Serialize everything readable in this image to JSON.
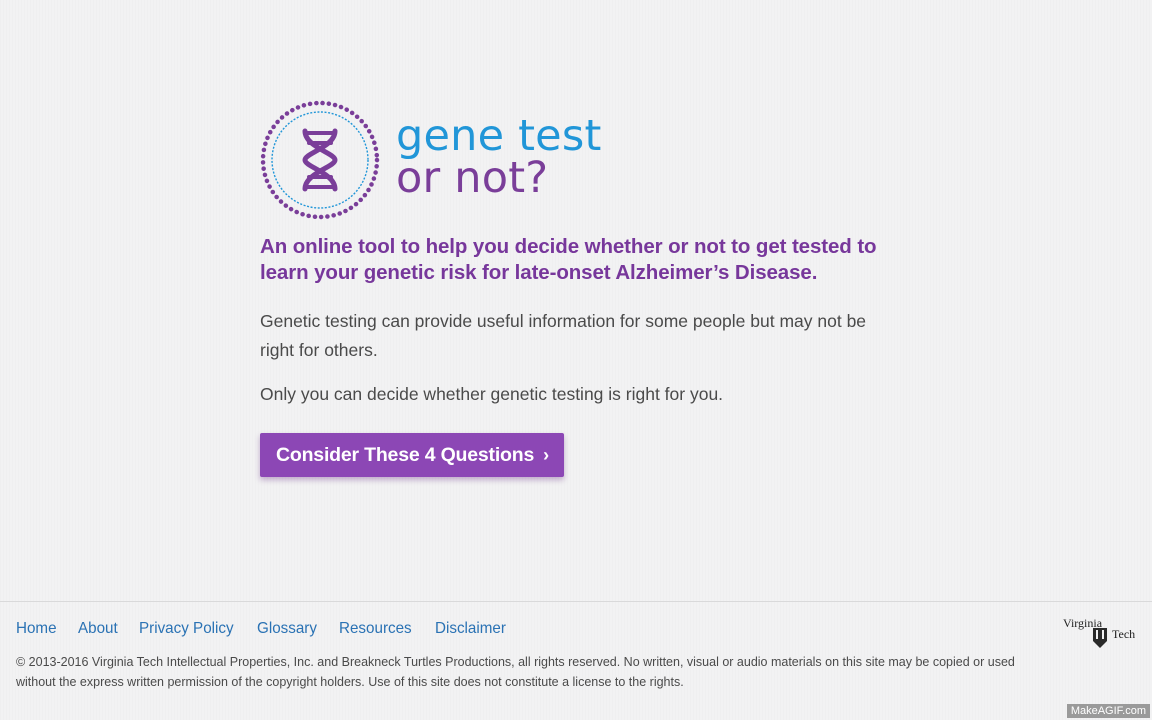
{
  "logo": {
    "line1": "gene test",
    "line2": "or not?",
    "badge_icon": "dna-icon"
  },
  "tagline": "An online tool to help you decide whether or not to get tested to learn your genetic risk for late-onset Alzheimer’s Disease.",
  "paragraphs": [
    "Genetic testing can provide useful information for some people but may not be right for others.",
    "Only you can decide whether genetic testing is right for you."
  ],
  "cta": {
    "label": "Consider These 4 Questions",
    "chevron": "›"
  },
  "footer": {
    "nav": [
      {
        "label": "Home"
      },
      {
        "label": "About"
      },
      {
        "label": "Privacy Policy"
      },
      {
        "label": "Glossary"
      },
      {
        "label": "Resources"
      },
      {
        "label": "Disclaimer"
      }
    ],
    "copyright": "© 2013-2016 Virginia Tech Intellectual Properties, Inc. and Breakneck Turtles Productions, all rights reserved. No written, visual or audio materials on this site may be copied or used without the express written permission of the copyright holders. Use of this site does not constitute a license to the rights.",
    "vt_logo": {
      "word1": "Virginia",
      "word2": "Tech"
    }
  },
  "watermark": "MakeAGIF.com",
  "colors": {
    "brand_purple": "#7a3e99",
    "brand_blue": "#2196d8",
    "button": "#8c47b5",
    "link": "#2a72b4"
  }
}
